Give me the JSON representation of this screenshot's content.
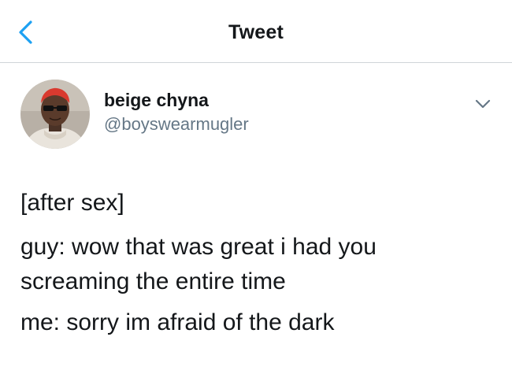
{
  "header": {
    "title": "Tweet",
    "back_icon": "chevron-left-icon"
  },
  "tweet": {
    "author": {
      "display_name": "beige chyna",
      "handle": "@boyswearmugler"
    },
    "menu_icon": "chevron-down-icon",
    "lines": [
      "[after sex]",
      "guy: wow that was great i had you",
      "screaming the entire time",
      "me: sorry im afraid of the dark"
    ]
  },
  "colors": {
    "text_primary": "#14171a",
    "text_secondary": "#657786",
    "accent": "#1da1f2",
    "divider": "#cfd4d9"
  }
}
